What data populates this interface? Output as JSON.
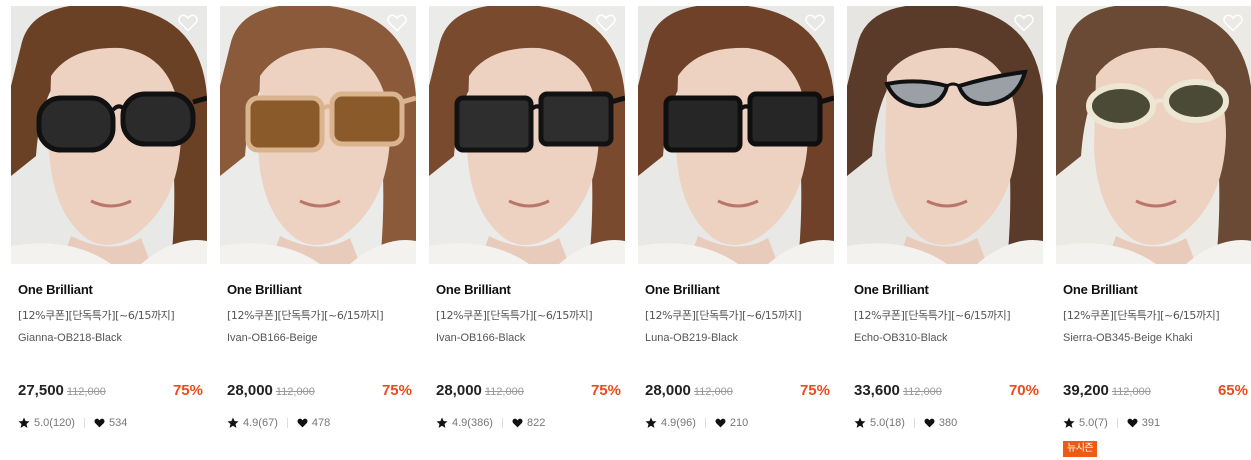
{
  "products": [
    {
      "brand": "One Brilliant",
      "promo": "[12%쿠폰][단독특가][~6/15까지]",
      "model": "Gianna-OB218-Black",
      "price": "27,500",
      "original_price": "112,000",
      "discount": "75%",
      "rating": "5.0(120)",
      "likes": "534",
      "lens_color": "#2b2b2b",
      "frame_color": "#111111",
      "hair_color": "#6b4126",
      "bg_color": "#e8e8e6"
    },
    {
      "brand": "One Brilliant",
      "promo": "[12%쿠폰][단독특가][~6/15까지]",
      "model": "Ivan-OB166-Beige",
      "price": "28,000",
      "original_price": "112,000",
      "discount": "75%",
      "rating": "4.9(67)",
      "likes": "478",
      "lens_color": "#8a5a2a",
      "frame_color": "#d9b48f",
      "hair_color": "#8b5a3a",
      "bg_color": "#ebebea"
    },
    {
      "brand": "One Brilliant",
      "promo": "[12%쿠폰][단독특가][~6/15까지]",
      "model": "Ivan-OB166-Black",
      "price": "28,000",
      "original_price": "112,000",
      "discount": "75%",
      "rating": "4.9(386)",
      "likes": "822",
      "lens_color": "#2e2e2e",
      "frame_color": "#121212",
      "hair_color": "#7a4a2f",
      "bg_color": "#ebebea"
    },
    {
      "brand": "One Brilliant",
      "promo": "[12%쿠폰][단독특가][~6/15까지]",
      "model": "Luna-OB219-Black",
      "price": "28,000",
      "original_price": "112,000",
      "discount": "75%",
      "rating": "4.9(96)",
      "likes": "210",
      "lens_color": "#262626",
      "frame_color": "#0f0f0f",
      "hair_color": "#6e4128",
      "bg_color": "#e8e8e6"
    },
    {
      "brand": "One Brilliant",
      "promo": "[12%쿠폰][단독특가][~6/15까지]",
      "model": "Echo-OB310-Black",
      "price": "33,600",
      "original_price": "112,000",
      "discount": "70%",
      "rating": "5.0(18)",
      "likes": "380",
      "lens_color": "#9aa0a6",
      "frame_color": "#111111",
      "hair_color": "#5a3a28",
      "bg_color": "#e6e5e1"
    },
    {
      "brand": "One Brilliant",
      "promo": "[12%쿠폰][단독특가][~6/15까지]",
      "model": "Sierra-OB345-Beige Khaki",
      "price": "39,200",
      "original_price": "112,000",
      "discount": "65%",
      "rating": "5.0(7)",
      "likes": "391",
      "badge": "뉴시즌",
      "lens_color": "#4b4a36",
      "frame_color": "#ece6d2",
      "hair_color": "#6a4a34",
      "bg_color": "#eceae5"
    }
  ],
  "colors": {
    "discount": "#ec4b1c",
    "badge": "#ec5a14",
    "skin": "#edd2c2"
  },
  "icons": {
    "wishlist": "heart-outline-icon",
    "rating": "star-icon",
    "likes": "heart-filled-icon"
  }
}
